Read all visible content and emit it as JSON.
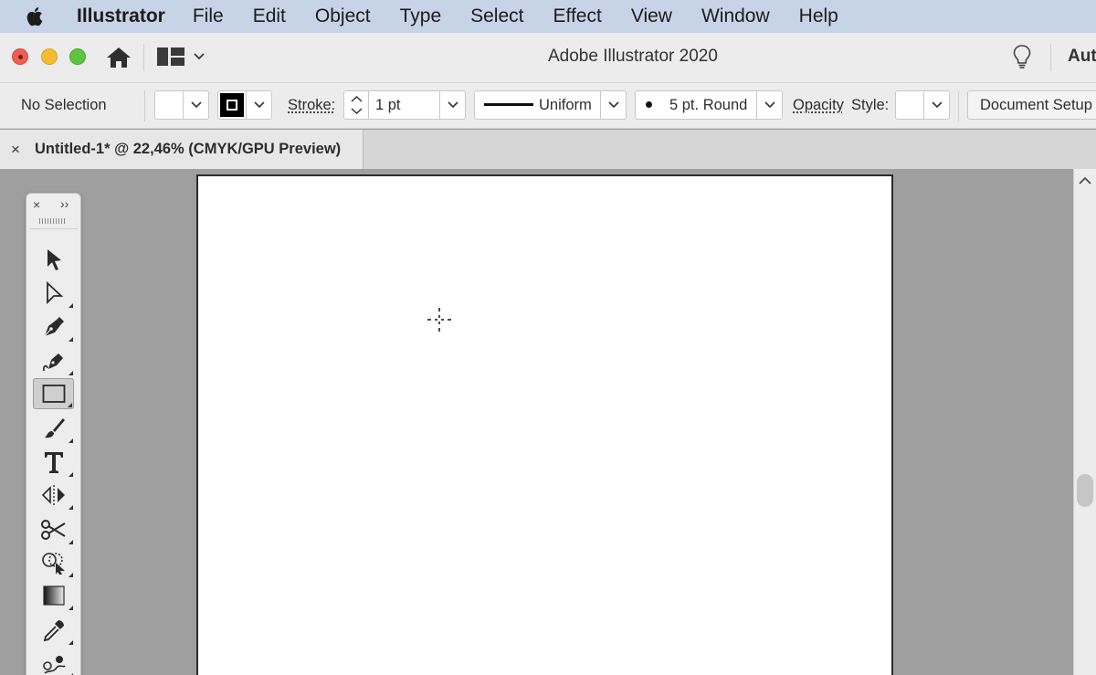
{
  "menubar": {
    "app_name": "Illustrator",
    "items": [
      "File",
      "Edit",
      "Object",
      "Type",
      "Select",
      "Effect",
      "View",
      "Window",
      "Help"
    ]
  },
  "titlebar": {
    "title": "Adobe Illustrator 2020",
    "right_label": "Aut"
  },
  "controlbar": {
    "selection_status": "No Selection",
    "stroke_label": "Stroke:",
    "stroke_weight": "1 pt",
    "profile_label": "Uniform",
    "brush_label": "5 pt. Round",
    "opacity_label": "Opacity",
    "style_label": "Style:",
    "doc_setup_label": "Document Setup"
  },
  "document": {
    "tab_close": "×",
    "tab_title": "Untitled-1* @ 22,46% (CMYK/GPU Preview)"
  },
  "toolbar": {
    "close_glyph": "×",
    "expand_glyph": "››",
    "tools": [
      {
        "name": "selection-tool",
        "icon": "arrow-icon",
        "has_flyout": false,
        "active": false
      },
      {
        "name": "direct-selection-tool",
        "icon": "hollow-arrow-icon",
        "has_flyout": true,
        "active": false
      },
      {
        "name": "pen-tool",
        "icon": "pen-icon",
        "has_flyout": true,
        "active": false
      },
      {
        "name": "curvature-tool",
        "icon": "curvature-pen-icon",
        "has_flyout": true,
        "active": false
      },
      {
        "name": "rectangle-tool",
        "icon": "rectangle-icon",
        "has_flyout": true,
        "active": true
      },
      {
        "name": "paintbrush-tool",
        "icon": "brush-icon",
        "has_flyout": true,
        "active": false
      },
      {
        "name": "type-tool",
        "icon": "type-icon",
        "has_flyout": true,
        "active": false
      },
      {
        "name": "reflect-tool",
        "icon": "reflect-icon",
        "has_flyout": true,
        "active": false
      },
      {
        "name": "scissors-tool",
        "icon": "scissors-icon",
        "has_flyout": true,
        "active": false
      },
      {
        "name": "shape-builder-tool",
        "icon": "shape-builder-icon",
        "has_flyout": true,
        "active": false
      },
      {
        "name": "gradient-tool",
        "icon": "gradient-icon",
        "has_flyout": true,
        "active": false
      },
      {
        "name": "eyedropper-tool",
        "icon": "eyedropper-icon",
        "has_flyout": true,
        "active": false
      },
      {
        "name": "blend-tool",
        "icon": "blend-icon",
        "has_flyout": true,
        "active": false
      }
    ]
  },
  "colors": {
    "menubar_bg": "#c7d3e6",
    "chrome_bg": "#ececec",
    "canvas_bg": "#9f9f9f",
    "artboard_bg": "#ffffff",
    "active_tool_bg": "#cfcfcf"
  }
}
